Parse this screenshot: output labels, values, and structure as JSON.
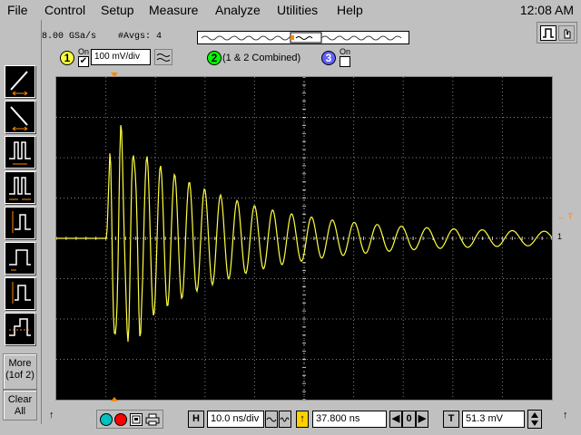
{
  "menu": {
    "items": [
      "File",
      "Control",
      "Setup",
      "Measure",
      "Analyze",
      "Utilities",
      "Help"
    ],
    "clock": "12:08 AM"
  },
  "status": {
    "sample_rate": "8.00 GSa/s",
    "averages": "#Avgs: 4"
  },
  "channels": {
    "ch1": {
      "number": "1",
      "on_label": "On",
      "on_checked": true,
      "scale": "100 mV/div"
    },
    "ch2": {
      "number": "2",
      "label": "(1 & 2 Combined)"
    },
    "ch3": {
      "number": "3",
      "on_label": "On",
      "on_checked": false
    }
  },
  "sidebar": {
    "more_label_line1": "More",
    "more_label_line2": "(1of 2)",
    "clear_label_line1": "Clear",
    "clear_label_line2": "All"
  },
  "screen": {
    "trigger_marker": "← T",
    "ground_marker": "1"
  },
  "bottom": {
    "time_scale_label": "H",
    "time_scale": "10.0 ns/div",
    "delay": "37.800 ns",
    "delay_nav": "0",
    "trigger_label": "T",
    "trigger_level": "51.3 mV"
  },
  "colors": {
    "trace": "#ffff40",
    "ch1_badge": "#ffff40",
    "ch2_badge": "#00ff00",
    "ch3_badge": "#6060ff",
    "marker": "#ff8800",
    "grid": "#808080"
  },
  "icons": {
    "dot1": "cyan-circle-icon",
    "dot2": "red-record-icon",
    "save": "save-waveform-icon",
    "print": "printer-icon"
  }
}
